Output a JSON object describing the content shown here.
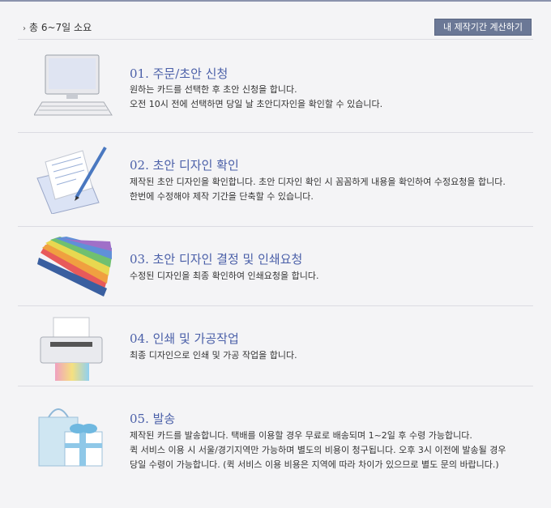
{
  "header": {
    "total": "총 6~7일 소요",
    "calc_button": "내 제작기간 계산하기"
  },
  "steps": [
    {
      "title": "01. 주문/초안 신청",
      "lines": [
        "원하는 카드를 선택한 후 초안 신청을 합니다.",
        "오전 10시 전에 선택하면 당일 날 초안디자인을 확인할 수 있습니다."
      ],
      "icon": "computer-icon"
    },
    {
      "title": "02. 초안 디자인 확인",
      "lines": [
        "제작된 초안 디자인을 확인합니다. 초안 디자인 확인 시 꼼꼼하게 내용을 확인하여 수정요청을 합니다.",
        "한번에 수정해야 제작 기간을 단축할 수 있습니다."
      ],
      "icon": "envelope-pen-icon"
    },
    {
      "title": "03. 초안 디자인 결정 및 인쇄요청",
      "lines": [
        "수정된 디자인을 최종 확인하여 인쇄요청을 합니다."
      ],
      "icon": "color-swatch-icon"
    },
    {
      "title": "04. 인쇄 및 가공작업",
      "lines": [
        "최종 디자인으로 인쇄 및 가공 작업을 합니다."
      ],
      "icon": "printer-icon"
    },
    {
      "title": "05. 발송",
      "lines": [
        "제작된 카드를 발송합니다. 택배를 이용할 경우 무료로 배송되며 1~2일 후 수령 가능합니다.",
        "퀵 서비스 이용 시 서울/경기지역만 가능하며 별도의 비용이 청구됩니다. 오후 3시 이전에 발송될 경우",
        "당일 수령이 가능합니다. (퀵 서비스 이용 비용은 지역에 따라 차이가 있으므로 별도 문의 바랍니다.)"
      ],
      "icon": "gift-bag-icon"
    }
  ]
}
